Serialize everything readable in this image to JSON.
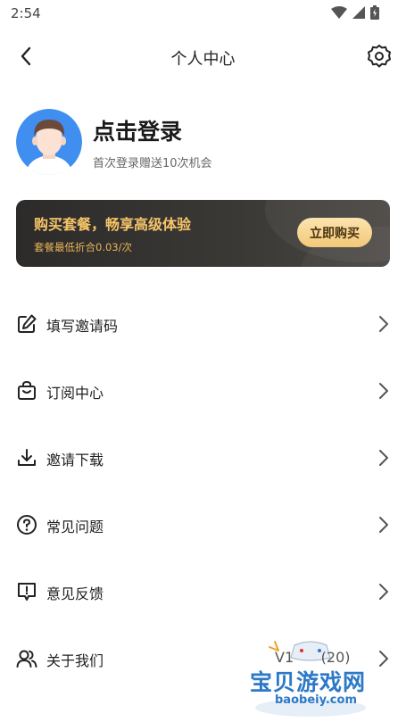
{
  "status_bar": {
    "time": "2:54"
  },
  "header": {
    "title": "个人中心"
  },
  "profile": {
    "login_label": "点击登录",
    "subtitle": "首次登录赠送10次机会"
  },
  "vip_banner": {
    "title": "购买套餐，畅享高级体验",
    "subtitle": "套餐最低折合0.03/次",
    "button_label": "立即购买",
    "colors": {
      "title": "#f6c56a",
      "button": "#f3c878",
      "background": "#2c2b2a"
    }
  },
  "menu": {
    "items": [
      {
        "label": "填写邀请码",
        "icon": "edit-icon"
      },
      {
        "label": "订阅中心",
        "icon": "shopping-bag-icon"
      },
      {
        "label": "邀请下载",
        "icon": "download-icon"
      },
      {
        "label": "常见问题",
        "icon": "help-circle-icon"
      },
      {
        "label": "意见反馈",
        "icon": "feedback-icon"
      },
      {
        "label": "关于我们",
        "icon": "users-icon"
      }
    ]
  },
  "watermark": {
    "version": "V1",
    "version_suffix": "(20)",
    "title": "宝贝游戏网",
    "url": "baobeiy.com"
  }
}
